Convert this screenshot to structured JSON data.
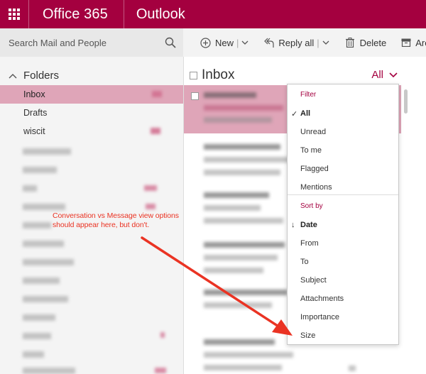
{
  "topbar": {
    "brand": "Office 365",
    "app_name": "Outlook"
  },
  "search": {
    "placeholder": "Search Mail and People"
  },
  "toolbar": {
    "new_label": "New",
    "reply_all_label": "Reply all",
    "delete_label": "Delete",
    "archive_label": "Arch"
  },
  "sidebar": {
    "folders_label": "Folders",
    "items": [
      {
        "label": "Inbox"
      },
      {
        "label": "Drafts"
      },
      {
        "label": "wiscit"
      }
    ]
  },
  "message_list": {
    "title": "Inbox",
    "filter_label": "All"
  },
  "filter_menu": {
    "filter_header": "Filter",
    "filter_options": [
      "All",
      "Unread",
      "To me",
      "Flagged",
      "Mentions"
    ],
    "filter_selected": "All",
    "sort_header": "Sort by",
    "sort_options": [
      "Date",
      "From",
      "To",
      "Subject",
      "Attachments",
      "Importance",
      "Size"
    ],
    "sort_selected": "Date"
  },
  "annotation": {
    "text": "Conversation vs Message view options should appear here, but don't."
  },
  "colors": {
    "brand": "#a4003f",
    "selection": "#dfa5b8",
    "annotation": "#ea3323"
  },
  "icons": {
    "app_launcher": "waffle-icon",
    "search": "search-icon",
    "new": "plus-circle-icon",
    "reply_all": "reply-all-icon",
    "delete": "trash-icon",
    "archive": "archive-icon",
    "folders_toggle": "chevron-up-icon",
    "filter_dropdown": "chevron-down-icon",
    "check": "checkmark-icon",
    "sort_direction": "arrow-down-icon"
  }
}
